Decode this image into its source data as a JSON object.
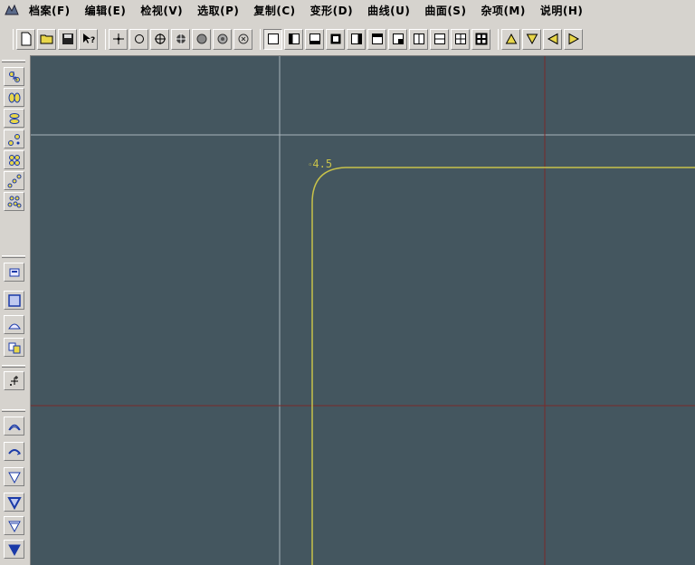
{
  "menu": {
    "items": [
      {
        "label": "档案(F)"
      },
      {
        "label": "编辑(E)"
      },
      {
        "label": "检视(V)"
      },
      {
        "label": "选取(P)"
      },
      {
        "label": "复制(C)"
      },
      {
        "label": "变形(D)"
      },
      {
        "label": "曲线(U)"
      },
      {
        "label": "曲面(S)"
      },
      {
        "label": "杂项(M)"
      },
      {
        "label": "说明(H)"
      }
    ]
  },
  "viewport": {
    "background_color": "#44565f",
    "curve_color": "#c8c24a",
    "dimension_label": "4.5"
  },
  "colors": {
    "ui_face": "#d6d3ce",
    "axis_red": "#7a2a2a",
    "guide_light": "#a9b4bb",
    "accent_yellow": "#e8d64a",
    "accent_blue": "#1a3aa8"
  }
}
